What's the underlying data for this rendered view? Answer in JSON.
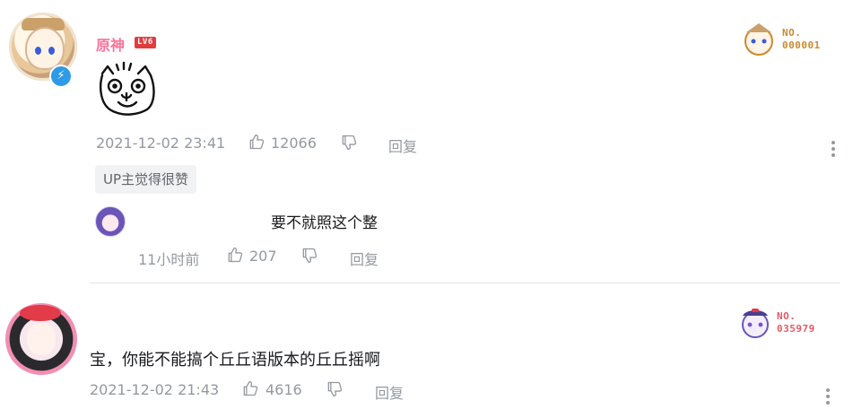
{
  "comment1": {
    "username": "原神",
    "level": "LV6",
    "fan_badge_label": "NO.",
    "fan_badge_number": "000001",
    "date": "2021-12-02 23:41",
    "likes": "12066",
    "reply_label": "回复",
    "tag": "UP主觉得很赞",
    "sub_reply": {
      "text": "要不就照这个整",
      "time": "11小时前",
      "likes": "207",
      "reply_label": "回复"
    }
  },
  "comment2": {
    "text": "宝，你能不能搞个丘丘语版本的丘丘摇啊",
    "fan_badge_label": "NO.",
    "fan_badge_number": "035979",
    "date": "2021-12-02 21:43",
    "likes": "4616",
    "reply_label": "回复"
  },
  "colors": {
    "username": "#fb7299",
    "meta_gray": "#9499a0",
    "badge_gold": "#c98a2e",
    "badge_red": "#e35a67",
    "level_red": "#e33b3b"
  }
}
